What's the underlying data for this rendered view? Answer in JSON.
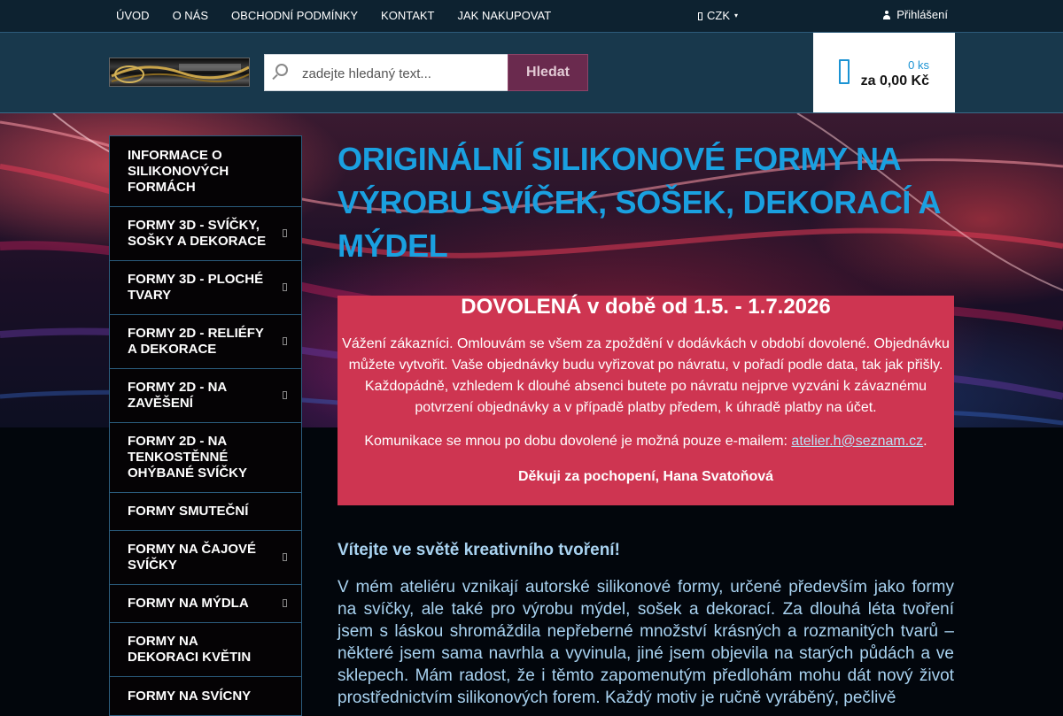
{
  "topnav": {
    "items": [
      "ÚVOD",
      "O NÁS",
      "OBCHODNÍ PODMÍNKY",
      "KONTAKT",
      "JAK NAKUPOVAT"
    ],
    "currency": "CZK",
    "login": "Přihlášení"
  },
  "search": {
    "placeholder": "zadejte hledaný text...",
    "button": "Hledat"
  },
  "cart": {
    "count": "0 ks",
    "total": "za 0,00 Kč"
  },
  "sidebar": {
    "categories": [
      {
        "label": "INFORMACE O SILIKONOVÝCH FORMÁCH",
        "submenu": false
      },
      {
        "label": "FORMY 3D - SVÍČKY, SOŠKY A DEKORACE",
        "submenu": true
      },
      {
        "label": "FORMY 3D - PLOCHÉ TVARY",
        "submenu": true
      },
      {
        "label": "FORMY 2D - RELIÉFY A DEKORACE",
        "submenu": true
      },
      {
        "label": "FORMY 2D - NA ZAVĚŠENÍ",
        "submenu": true
      },
      {
        "label": "FORMY 2D - NA TENKOSTĚNNÉ OHÝBANÉ SVÍČKY",
        "submenu": false
      },
      {
        "label": "FORMY SMUTEČNÍ",
        "submenu": false
      },
      {
        "label": "FORMY NA ČAJOVÉ SVÍČKY",
        "submenu": true
      },
      {
        "label": "FORMY NA MÝDLA",
        "submenu": true
      },
      {
        "label": "FORMY NA DEKORACI KVĚTIN",
        "submenu": false
      },
      {
        "label": "FORMY NA SVÍCNY",
        "submenu": false
      }
    ]
  },
  "main": {
    "title": "ORIGINÁLNÍ SILIKONOVÉ FORMY NA VÝROBU SVÍČEK, SOŠEK, DEKORACÍ A MÝDEL",
    "notice": {
      "title": "DOVOLENÁ v době od 1.5. - 1.7.2026",
      "text": "Vážení zákazníci. Omlouvám se všem za zpoždění v dodávkách v období dovolené. Objednávku můžete vytvořit. Vaše objednávky budu vyřizovat po návratu, v pořadí podle data, tak jak přišly. Každopádně, vzhledem k dlouhé absenci butete po návratu nejprve vyzváni k závaznému potvrzení objednávky a v případě platby předem, k úhradě platby na účet.",
      "contact_prefix": "Komunikace se mnou po dobu dovolené je možná pouze e-mailem: ",
      "contact_email": "atelier.h@seznam.cz",
      "contact_suffix": ".",
      "thanks": "Děkuji za pochopení, Hana Svatoňová"
    },
    "welcome": "Vítejte ve světě kreativního tvoření!",
    "intro": "V mém ateliéru vznikají autorské silikonové formy, určené především jako formy na svíčky, ale také pro výrobu mýdel, sošek a dekorací. Za dlouhá léta tvoření jsem s láskou shromáždila nepřeberné množství krásných a rozmanitých tvarů – některé jsem sama navrhla a vyvinula, jiné jsem objevila na starých půdách a ve sklepech. Mám radost, že i těmto zapomenutým předlohám mohu dát nový život prostřednictvím silikonových forem. Každý motiv je ručně vyráběný, pečlivě"
  },
  "colors": {
    "accent_blue": "#1aa0e0",
    "notice_red": "#ce3551",
    "search_button": "#6a2a4e",
    "header_bg": "#18384c"
  }
}
